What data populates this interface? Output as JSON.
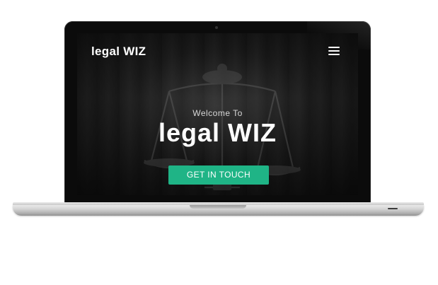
{
  "site": {
    "brand": "legal WIZ",
    "menu_icon": "hamburger-menu-icon",
    "hero": {
      "welcome": "Welcome To",
      "title": "legal WIZ",
      "cta_label": "GET IN TOUCH"
    }
  },
  "colors": {
    "cta_background": "#1fb486",
    "bezel": "#0b0b0b",
    "chassis": "#c9c9c9"
  }
}
